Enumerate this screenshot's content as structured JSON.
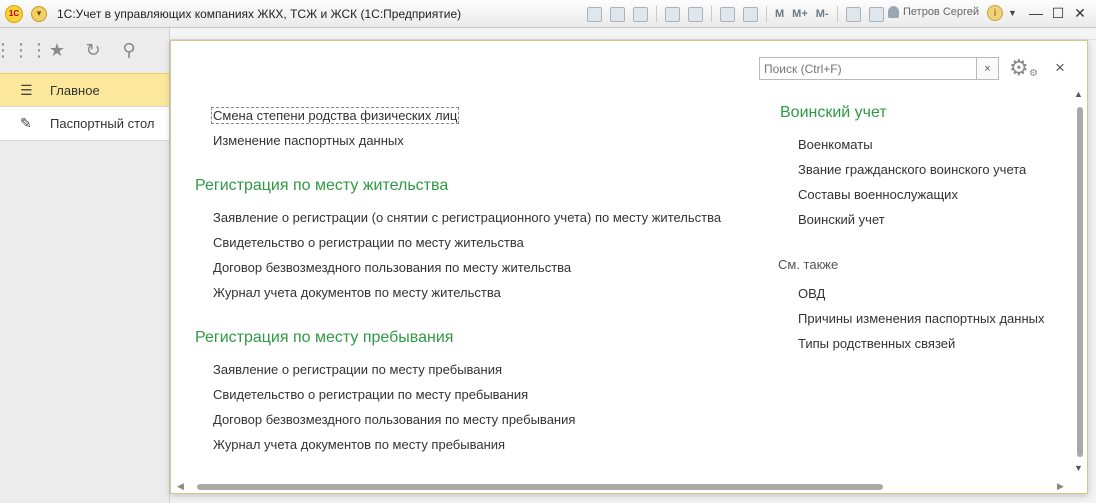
{
  "window": {
    "app_logo": "1С",
    "title": "1С:Учет в управляющих компаниях ЖКХ, ТСЖ и ЖСК  (1С:Предприятие)",
    "user": "Петров Сергей",
    "toolbar_text": [
      "M",
      "M+",
      "M-"
    ],
    "icons": [
      "save-icon",
      "print-icon",
      "preview-icon",
      "upload-icon",
      "download-icon",
      "table-icon",
      "calendar-icon",
      "zoom-icon",
      "panel-icon"
    ]
  },
  "sidebar": {
    "toolbar_icons": [
      "apps-icon",
      "star-icon",
      "history-icon",
      "search-icon"
    ],
    "items": [
      {
        "label": "Главное",
        "icon": "menu-icon"
      },
      {
        "label": "Паспортный стол",
        "icon": "passport-icon"
      }
    ]
  },
  "panel": {
    "search_placeholder": "Поиск (Ctrl+F)",
    "clear_label": "×",
    "close_label": "×",
    "left": {
      "top_links": [
        "Смена степени родства физических лиц",
        "Изменение паспортных данных"
      ],
      "reg_residence": {
        "title": "Регистрация по месту жительства",
        "links": [
          "Заявление о регистрации (о снятии с регистрационного учета) по месту жительства",
          "Свидетельство о регистрации по месту жительства",
          "Договор безвозмездного пользования по месту жительства",
          "Журнал учета документов по месту жительства"
        ]
      },
      "reg_stay": {
        "title": "Регистрация по месту пребывания",
        "links": [
          "Заявление о регистрации по месту пребывания",
          "Свидетельство о регистрации по месту пребывания",
          "Договор безвозмездного пользования по месту пребывания",
          "Журнал учета документов по месту пребывания"
        ]
      }
    },
    "right": {
      "military": {
        "title": "Воинский учет",
        "links": [
          "Военкоматы",
          "Звание гражданского воинского учета",
          "Составы военнослужащих",
          "Воинский учет"
        ]
      },
      "see_also": {
        "title": "См. также",
        "links": [
          "ОВД",
          "Причины изменения паспортных данных",
          "Типы родственных связей"
        ]
      }
    }
  },
  "colors": {
    "section_heading": "#2f9a44",
    "active_section": "#fbe89a",
    "panel_border": "#d3c78a"
  }
}
